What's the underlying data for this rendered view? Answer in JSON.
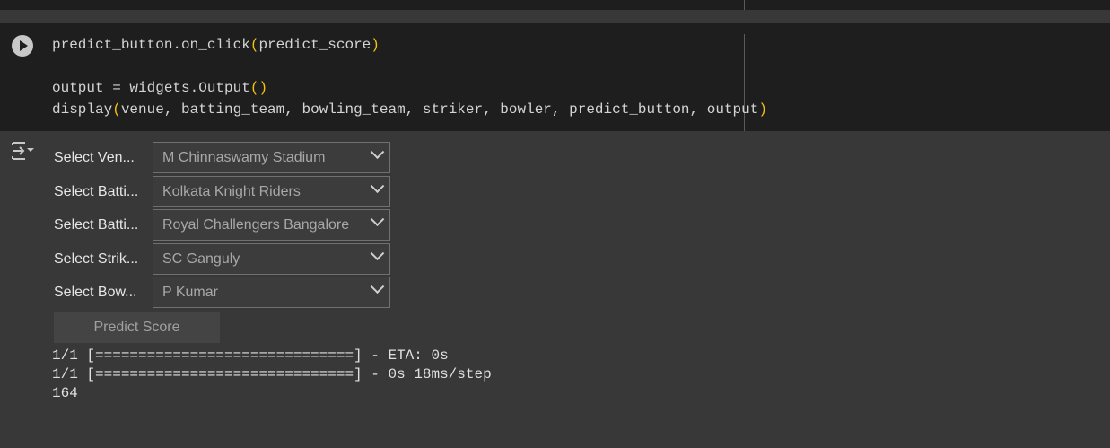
{
  "code_lines": [
    {
      "pre": "predict_button.on_click",
      "open": "(",
      "mid": "predict_score",
      "close": ")"
    },
    {
      "pre": "output = widgets.Output",
      "open": "(",
      "mid": "",
      "close": ")"
    },
    {
      "pre": "display",
      "open": "(",
      "mid": "venue, batting_team, bowling_team, striker, bowler, predict_button, output",
      "close": ")"
    }
  ],
  "widgets": [
    {
      "label": "Select Ven...",
      "value": "M Chinnaswamy Stadium"
    },
    {
      "label": "Select Batti...",
      "value": "Kolkata Knight Riders"
    },
    {
      "label": "Select Batti...",
      "value": "Royal Challengers Bangalore"
    },
    {
      "label": "Select Strik...",
      "value": "SC Ganguly"
    },
    {
      "label": "Select Bow...",
      "value": "P Kumar"
    }
  ],
  "predict_button_label": "Predict Score",
  "stdout": [
    "1/1 [==============================] - ETA: 0s",
    "1/1 [==============================] - 0s 18ms/step",
    "164"
  ]
}
